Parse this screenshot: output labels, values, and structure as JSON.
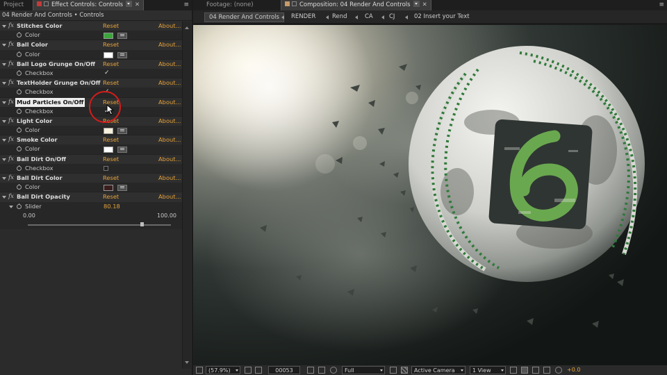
{
  "left_panel": {
    "tabs": {
      "project": "Project",
      "effect_controls": "Effect Controls: Controls"
    },
    "menu_glyph": "≡",
    "breadcrumb": "04 Render And Controls • Controls",
    "effects": [
      {
        "name": "Stitches Color",
        "reset": "Reset",
        "about": "About...",
        "prop": "Color",
        "kind": "color",
        "color": "#3aa63a"
      },
      {
        "name": "Ball Color",
        "reset": "Reset",
        "about": "About...",
        "prop": "Color",
        "kind": "color",
        "color": "#ffffff"
      },
      {
        "name": "Ball Logo Grunge On/Off",
        "reset": "Reset",
        "about": "About...",
        "prop": "Checkbox",
        "kind": "check",
        "checked": true
      },
      {
        "name": "TextHolder Grunge On/Off",
        "reset": "Reset",
        "about": "About...",
        "prop": "Checkbox",
        "kind": "check",
        "checked": true
      },
      {
        "name": "Mud Particles On/Off",
        "reset": "Reset",
        "about": "About...",
        "prop": "Checkbox",
        "kind": "check",
        "checked": true,
        "selected": true
      },
      {
        "name": "Light Color",
        "reset": "Reset",
        "about": "About...",
        "prop": "Color",
        "kind": "color",
        "color": "#f6f0dc"
      },
      {
        "name": "Smoke Color",
        "reset": "Reset",
        "about": "About...",
        "prop": "Color",
        "kind": "color",
        "color": "#ffffff"
      },
      {
        "name": "Ball Dirt On/Off",
        "reset": "Reset",
        "about": "About...",
        "prop": "Checkbox",
        "kind": "check",
        "checked": false
      },
      {
        "name": "Ball Dirt Color",
        "reset": "Reset",
        "about": "About...",
        "prop": "Color",
        "kind": "color",
        "color": "#3a1e1e"
      },
      {
        "name": "Ball Dirt Opacity",
        "reset": "Reset",
        "about": "About...",
        "prop": "Slider",
        "kind": "slider",
        "value": "80.18",
        "min": "0.00",
        "max": "100.00",
        "fraction": 0.8018
      }
    ]
  },
  "comp_panel": {
    "tabs": {
      "footage": "Footage: (none)",
      "composition": "Composition: 04 Render And Controls"
    },
    "breadcrumbs": [
      "04 Render And Controls",
      "RENDER",
      "Rend",
      "CA",
      "CJ",
      "02 Insert your Text"
    ],
    "bottom_bar": {
      "zoom": "(57.9%)",
      "timecode": "00053",
      "resolution": "Full",
      "camera": "Active Camera",
      "views": "1 View",
      "exposure": "+0.0"
    }
  },
  "colors": {
    "accent_orange": "#e6a23a",
    "cursor_ring": "#d31c1c",
    "stitch_green": "#2f7a3a",
    "logo_green": "#6aa84f"
  }
}
